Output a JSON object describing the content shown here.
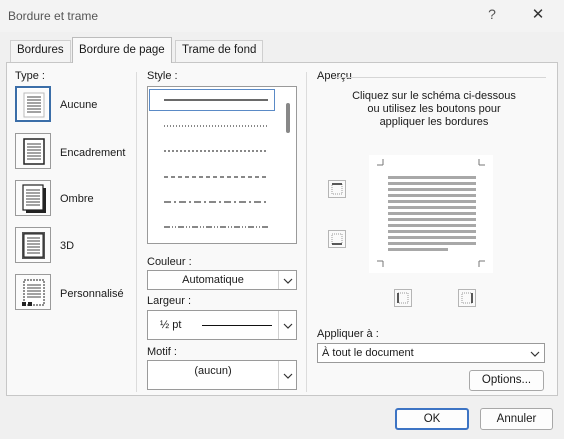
{
  "window": {
    "title": "Bordure et trame",
    "help_glyph": "?",
    "close_glyph": "✕"
  },
  "tabs": [
    {
      "label": "Bordures",
      "active": false
    },
    {
      "label": "Bordure de page",
      "active": true
    },
    {
      "label": "Trame de fond",
      "active": false
    }
  ],
  "type_section": {
    "label": "Type :",
    "items": [
      {
        "label": "Aucune",
        "selected": true,
        "icon": "border-none-icon"
      },
      {
        "label": "Encadrement",
        "selected": false,
        "icon": "border-box-icon"
      },
      {
        "label": "Ombre",
        "selected": false,
        "icon": "border-shadow-icon"
      },
      {
        "label": "3D",
        "selected": false,
        "icon": "border-3d-icon"
      },
      {
        "label": "Personnalisé",
        "selected": false,
        "icon": "border-custom-icon"
      }
    ]
  },
  "style_section": {
    "label": "Style :",
    "styles": [
      "solid",
      "dotted",
      "dashed-small",
      "dashed",
      "dash-dot",
      "dash-dot-dot"
    ]
  },
  "color": {
    "label": "Couleur :",
    "value": "Automatique"
  },
  "width": {
    "label": "Largeur :",
    "value": "½ pt"
  },
  "motif": {
    "label": "Motif :",
    "value": "(aucun)"
  },
  "preview": {
    "label": "Aperçu",
    "instructions": "Cliquez sur le schéma ci-dessous ou utilisez les boutons pour appliquer les bordures"
  },
  "apply": {
    "label": "Appliquer à :",
    "value": "À tout le document"
  },
  "buttons": {
    "options": "Options...",
    "ok": "OK",
    "cancel": "Annuler"
  },
  "colors": {
    "accent": "#3d74c4",
    "selection_border": "#5a8ac6"
  }
}
